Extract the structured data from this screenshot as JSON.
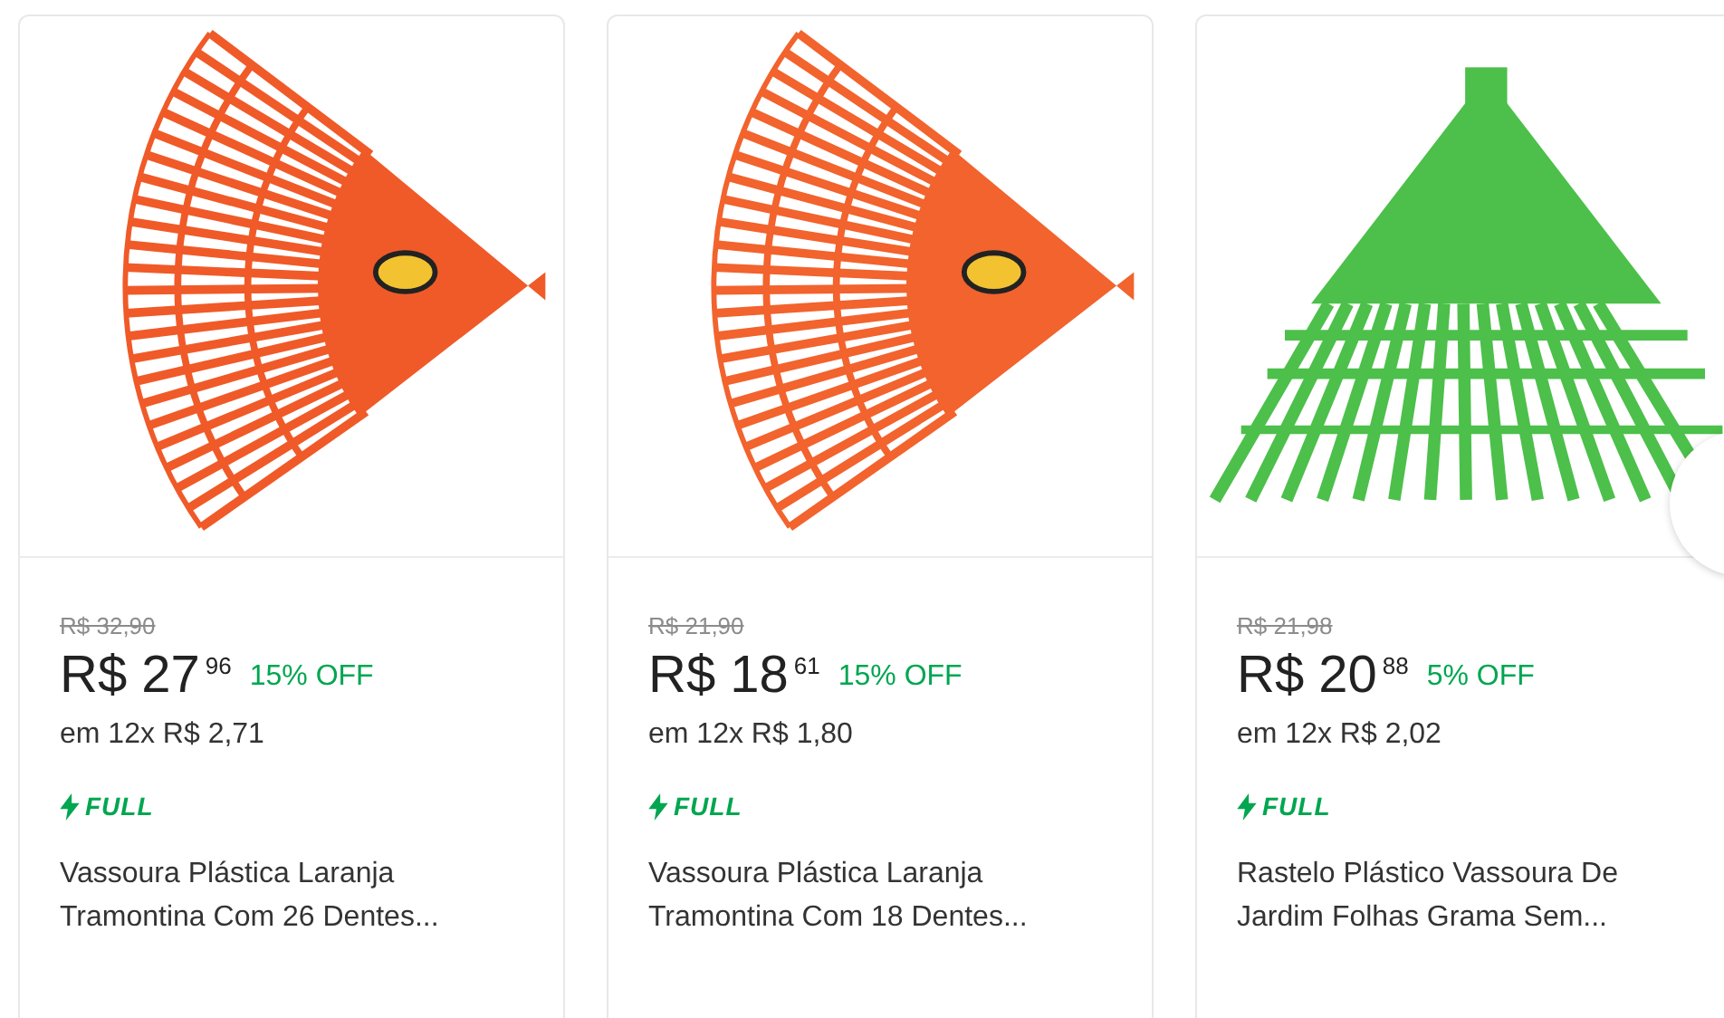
{
  "products": [
    {
      "image": {
        "kind": "fan",
        "color": "#f05a28"
      },
      "old_price": "R$ 32,90",
      "price": "R$ 27",
      "cents": "96",
      "discount": "15% OFF",
      "installments": "em 12x R$ 2,71",
      "badge": "FULL",
      "title": "Vassoura Plástica Laranja Tramontina Com 26 Dentes..."
    },
    {
      "image": {
        "kind": "fan",
        "color": "#f2632d"
      },
      "old_price": "R$ 21,90",
      "price": "R$ 18",
      "cents": "61",
      "discount": "15% OFF",
      "installments": "em 12x R$ 1,80",
      "badge": "FULL",
      "title": "Vassoura Plástica Laranja Tramontina Com 18 Dentes..."
    },
    {
      "image": {
        "kind": "triangle",
        "color": "#4cc04a"
      },
      "old_price": "R$ 21,98",
      "price": "R$ 20",
      "cents": "88",
      "discount": "5% OFF",
      "installments": "em 12x R$ 2,02",
      "badge": "FULL",
      "title": "Rastelo Plástico Vassoura De Jardim Folhas Grama Sem..."
    }
  ]
}
